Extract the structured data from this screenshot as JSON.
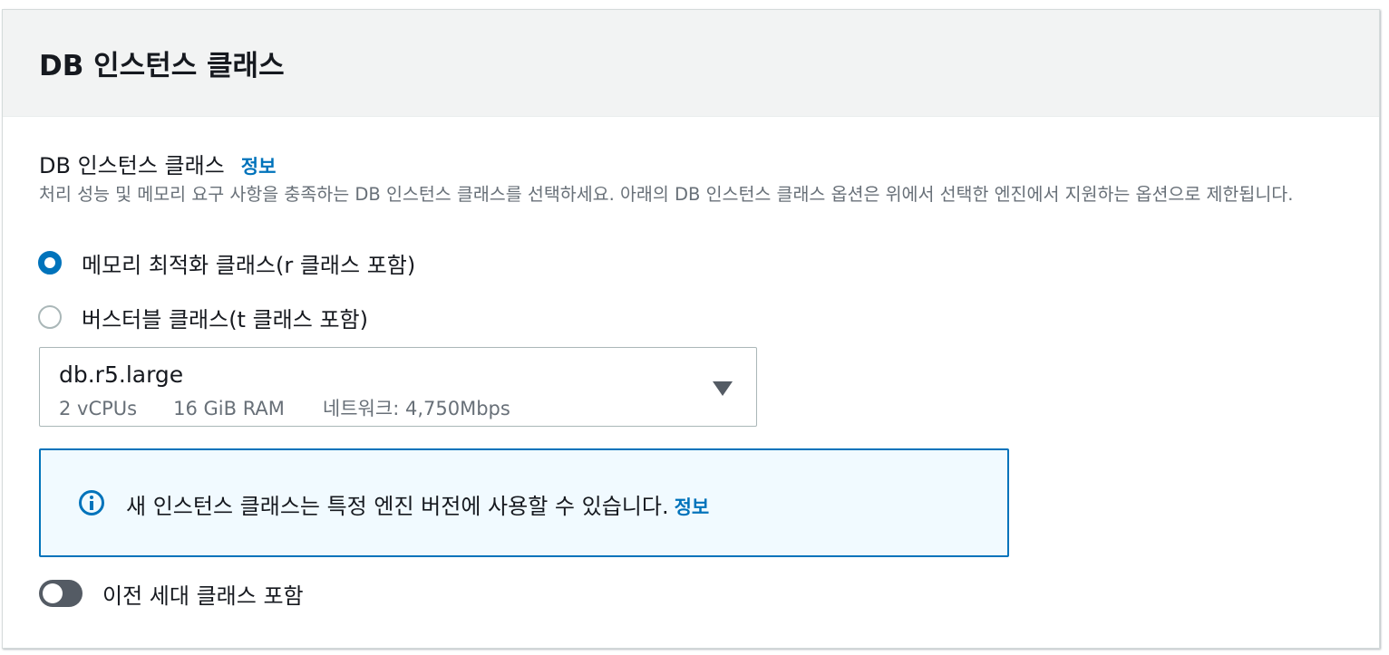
{
  "panel": {
    "title": "DB 인스턴스 클래스"
  },
  "field": {
    "label": "DB 인스턴스 클래스",
    "info_link": "정보",
    "description": "처리 성능 및 메모리 요구 사항을 충족하는 DB 인스턴스 클래스를 선택하세요. 아래의 DB 인스턴스 클래스 옵션은 위에서 선택한 엔진에서 지원하는 옵션으로 제한됩니다."
  },
  "class_options": [
    {
      "label": "메모리 최적화 클래스(r 클래스 포함)",
      "checked": true
    },
    {
      "label": "버스터블 클래스(t 클래스 포함)",
      "checked": false
    }
  ],
  "instance_select": {
    "value": "db.r5.large",
    "vcpus": "2 vCPUs",
    "ram": "16 GiB RAM",
    "network": "네트워크: 4,750Mbps",
    "icon": "caret-down-icon"
  },
  "alert": {
    "icon": "info-circle-icon",
    "text": "새 인스턴스 클래스는 특정 엔진 버전에 사용할 수 있습니다.",
    "info_link": "정보",
    "border_color": "#0073bb",
    "background": "#f1faff"
  },
  "previous_gen_toggle": {
    "label": "이전 세대 클래스 포함",
    "on": false
  },
  "colors": {
    "accent": "#0073bb",
    "text": "#16191f",
    "muted": "#687078",
    "header_bg": "#f2f3f3"
  }
}
